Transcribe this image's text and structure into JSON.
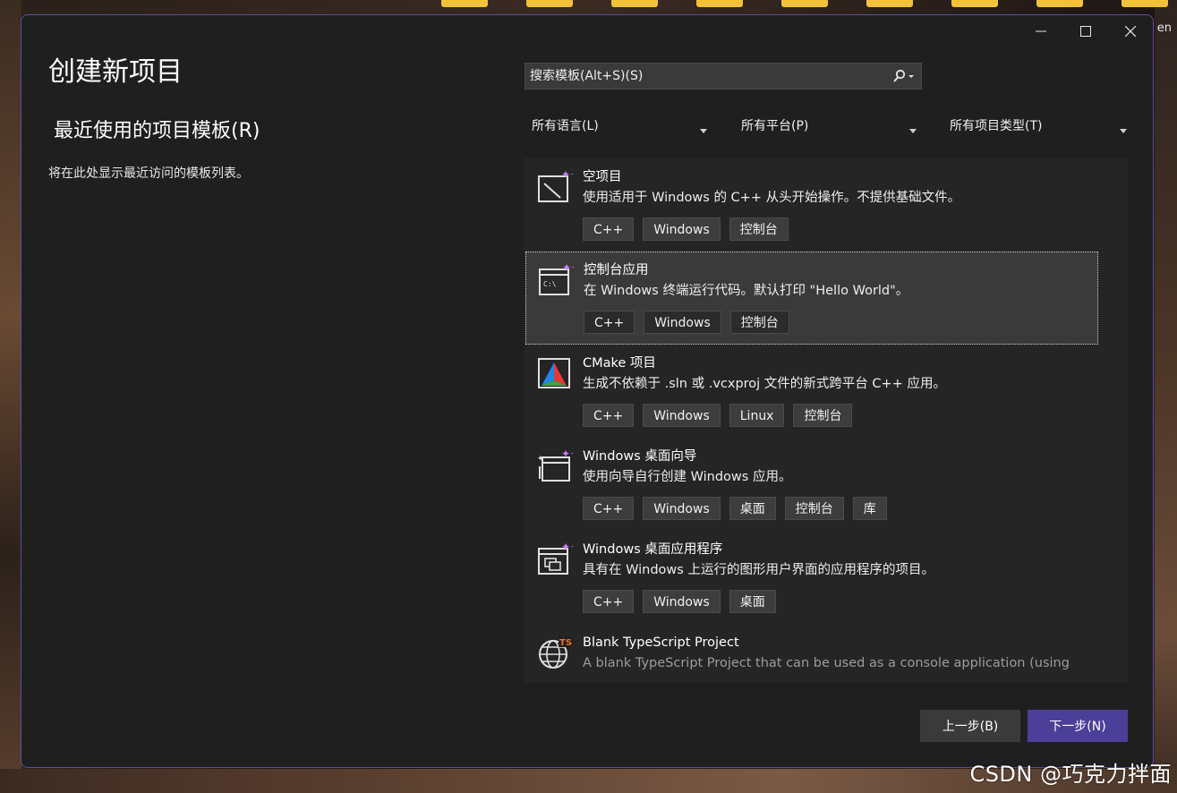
{
  "window": {
    "minimize_icon": "minimize-icon",
    "maximize_icon": "maximize-icon",
    "close_icon": "close-icon"
  },
  "page_title": "创建新项目",
  "recent": {
    "title": "最近使用的项目模板(R)",
    "description": "将在此处显示最近访问的模板列表。"
  },
  "search": {
    "placeholder": "搜索模板(Alt+S)(S)",
    "value": ""
  },
  "filters": {
    "language": "所有语言(L)",
    "platform": "所有平台(P)",
    "project_type": "所有项目类型(T)"
  },
  "templates": [
    {
      "name": "空项目",
      "description": "使用适用于 Windows 的 C++ 从头开始操作。不提供基础文件。",
      "icon": "empty-project-icon",
      "tags": [
        "C++",
        "Windows",
        "控制台"
      ]
    },
    {
      "name": "控制台应用",
      "description": "在 Windows 终端运行代码。默认打印 \"Hello World\"。",
      "icon": "console-app-icon",
      "tags": [
        "C++",
        "Windows",
        "控制台"
      ],
      "selected": true
    },
    {
      "name": "CMake 项目",
      "description": "生成不依赖于 .sln 或 .vcxproj 文件的新式跨平台 C++ 应用。",
      "icon": "cmake-icon",
      "tags": [
        "C++",
        "Windows",
        "Linux",
        "控制台"
      ]
    },
    {
      "name": "Windows 桌面向导",
      "description": "使用向导自行创建 Windows 应用。",
      "icon": "desktop-wizard-icon",
      "tags": [
        "C++",
        "Windows",
        "桌面",
        "控制台",
        "库"
      ]
    },
    {
      "name": "Windows 桌面应用程序",
      "description": "具有在 Windows 上运行的图形用户界面的应用程序的项目。",
      "icon": "desktop-app-icon",
      "tags": [
        "C++",
        "Windows",
        "桌面"
      ]
    },
    {
      "name": "Blank TypeScript Project",
      "description": "A blank TypeScript Project that can be used as a console application (using",
      "icon": "typescript-globe-icon",
      "tags": []
    }
  ],
  "buttons": {
    "back": "上一步(B)",
    "next": "下一步(N)"
  },
  "background": {
    "corner_text": "en",
    "watermark": "CSDN @巧克力拌面"
  },
  "colors": {
    "dialog_bg": "#1f1f1f",
    "accent": "#4b3f9a",
    "dialog_border": "#5a4fa0"
  }
}
